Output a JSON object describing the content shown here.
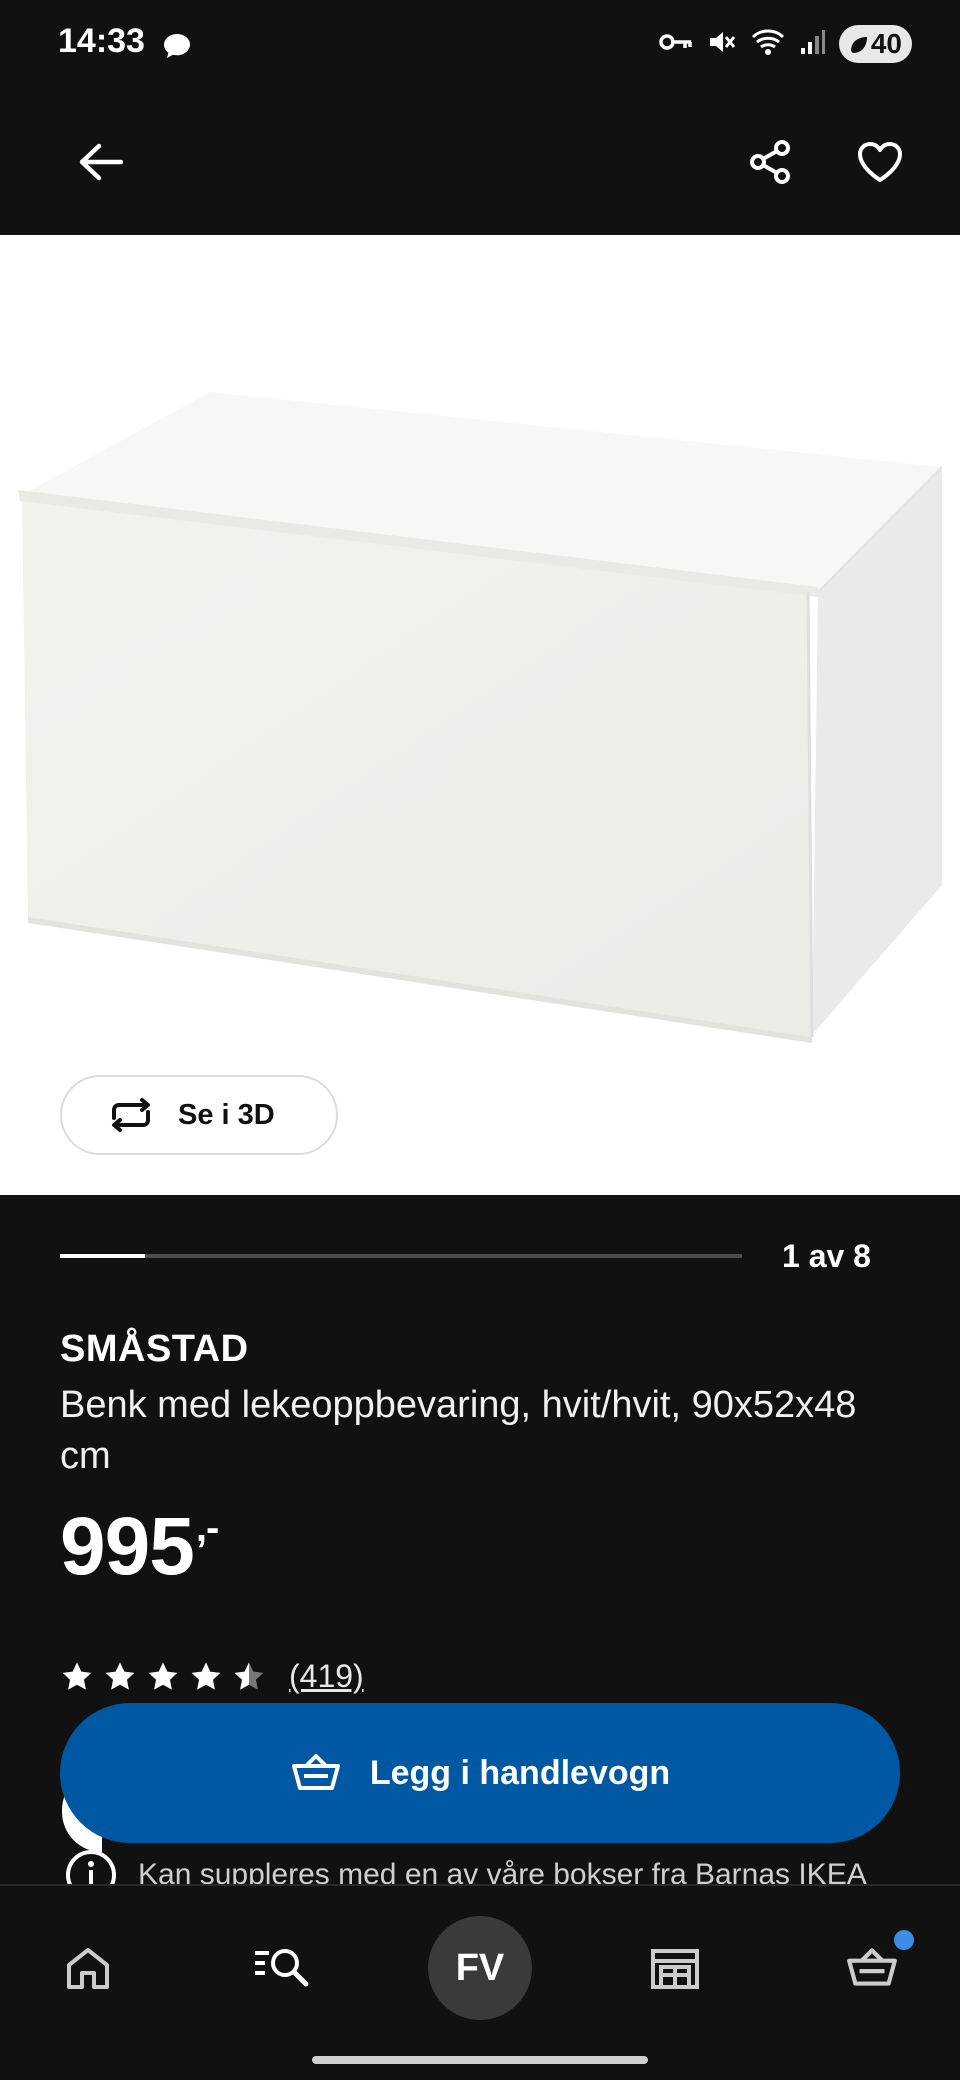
{
  "status_bar": {
    "time": "14:33",
    "battery": "40",
    "icons": [
      "chat-bubble-icon",
      "vpn-key-icon",
      "mute-icon",
      "wifi-icon",
      "signal-icon",
      "battery-icon"
    ]
  },
  "app_bar": {
    "icons": [
      "back-arrow-icon",
      "share-icon",
      "heart-icon"
    ]
  },
  "gallery": {
    "view_3d_label": "Se i 3D",
    "page_indicator": "1 av 8",
    "current_page": 1,
    "total_pages": 8
  },
  "product": {
    "name": "SMÅSTAD",
    "description": "Benk med lekeoppbevaring, hvit/hvit, 90x52x48 cm",
    "price": "995",
    "price_suffix": ",-",
    "rating": 4.5,
    "review_count": "(419)"
  },
  "cart_button": {
    "label": "Legg i handlevogn"
  },
  "info": {
    "text": "Kan suppleres med en av våre bokser fra Barnas IKEA"
  },
  "bottom_nav": {
    "profile_initials": "FV",
    "items": [
      "home-icon",
      "search-icon",
      "profile",
      "stores-icon",
      "cart-icon"
    ]
  },
  "colors": {
    "background": "#111111",
    "accent_blue": "#0058a3",
    "notification_dot": "#3d8de6"
  }
}
